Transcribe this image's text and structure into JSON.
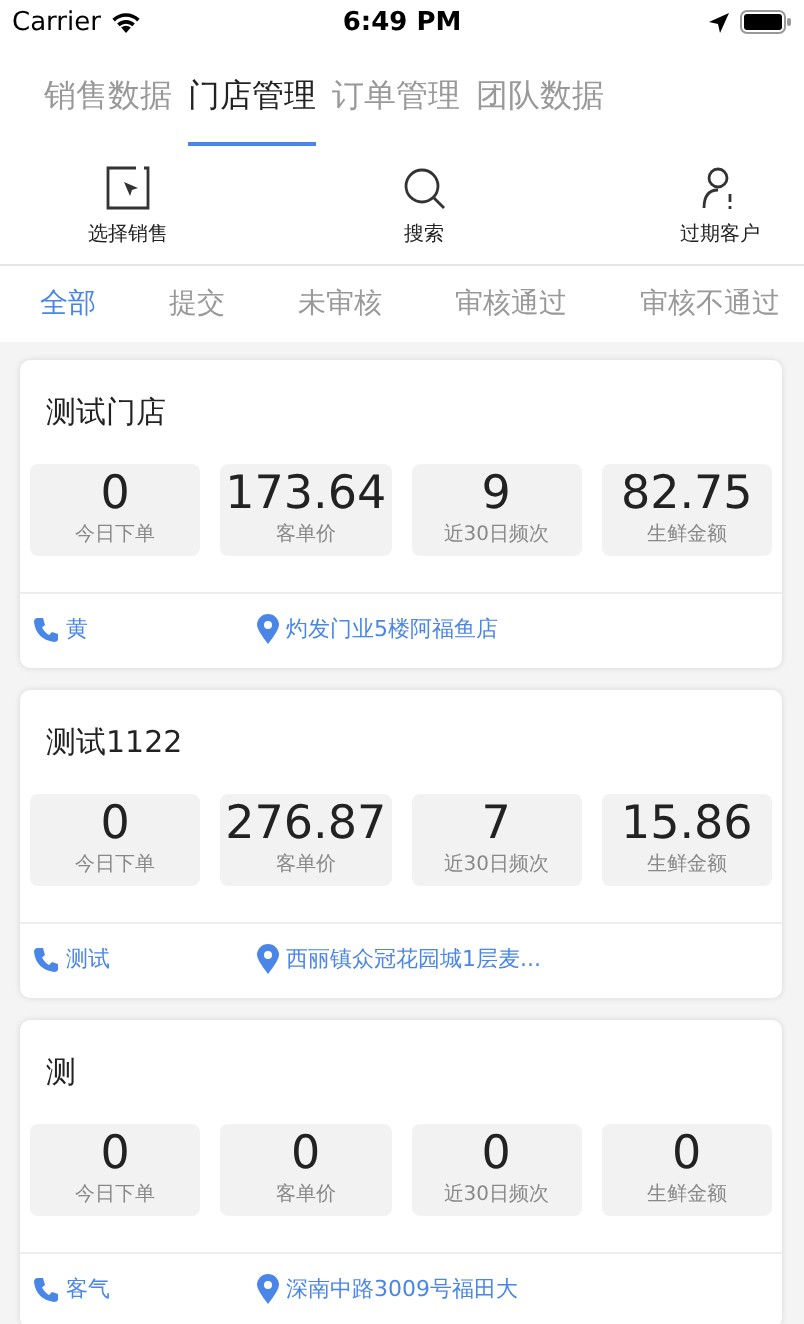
{
  "status_bar": {
    "carrier": "Carrier",
    "time": "6:49 PM"
  },
  "tabs": [
    {
      "label": "销售数据",
      "selected": false
    },
    {
      "label": "门店管理",
      "selected": true
    },
    {
      "label": "订单管理",
      "selected": false
    },
    {
      "label": "团队数据",
      "selected": false
    }
  ],
  "actions": [
    {
      "kind": "select",
      "label": "选择销售"
    },
    {
      "kind": "search",
      "label": "搜索"
    },
    {
      "kind": "expired",
      "label": "过期客户"
    }
  ],
  "filters": [
    {
      "label": "全部",
      "selected": true
    },
    {
      "label": "提交",
      "selected": false
    },
    {
      "label": "未审核",
      "selected": false
    },
    {
      "label": "审核通过",
      "selected": false
    },
    {
      "label": "审核不通过",
      "selected": false
    }
  ],
  "stores": [
    {
      "name": "测试门店",
      "stats": [
        {
          "value": "0",
          "label": "今日下单"
        },
        {
          "value": "173.64",
          "label": "客单价"
        },
        {
          "value": "9",
          "label": "近30日频次"
        },
        {
          "value": "82.75",
          "label": "生鲜金额"
        }
      ],
      "contact": "黄",
      "address": "灼发门业5楼阿福鱼店"
    },
    {
      "name": "测试1122",
      "stats": [
        {
          "value": "0",
          "label": "今日下单"
        },
        {
          "value": "276.87",
          "label": "客单价"
        },
        {
          "value": "7",
          "label": "近30日频次"
        },
        {
          "value": "15.86",
          "label": "生鲜金额"
        }
      ],
      "contact": "测试",
      "address": "西丽镇众冠花园城1层麦..."
    },
    {
      "name": "测",
      "stats": [
        {
          "value": "0",
          "label": "今日下单"
        },
        {
          "value": "0",
          "label": "客单价"
        },
        {
          "value": "0",
          "label": "近30日频次"
        },
        {
          "value": "0",
          "label": "生鲜金额"
        }
      ],
      "contact": "客气",
      "address": "深南中路3009号福田大"
    }
  ]
}
